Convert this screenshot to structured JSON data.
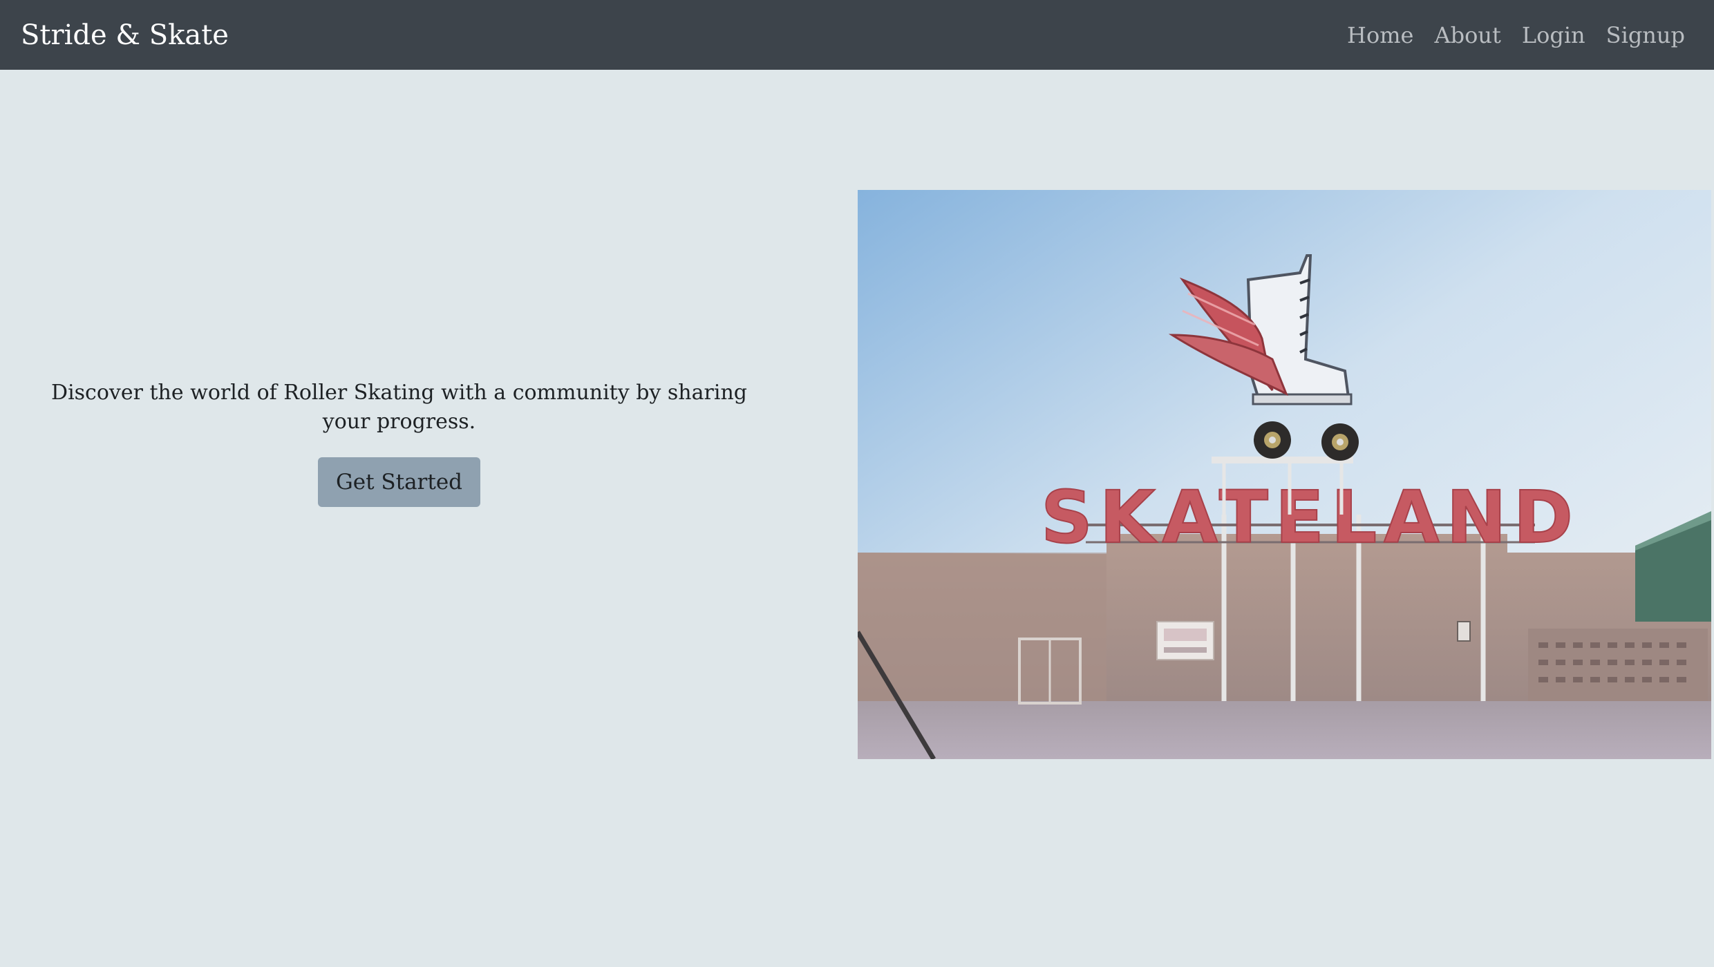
{
  "navbar": {
    "brand": "Stride & Skate",
    "links": [
      "Home",
      "About",
      "Login",
      "Signup"
    ]
  },
  "hero": {
    "tagline": "Discover the world of Roller Skating with a community by sharing your progress.",
    "cta_label": "Get Started"
  },
  "image": {
    "sign_text": "SKATELAND",
    "subject": "skateland-sign-photo"
  },
  "colors": {
    "navbar_bg": "#3d444b",
    "page_bg": "#dfe7ea",
    "cta_bg": "#8fa1b0",
    "sign_red": "#c65a62"
  }
}
